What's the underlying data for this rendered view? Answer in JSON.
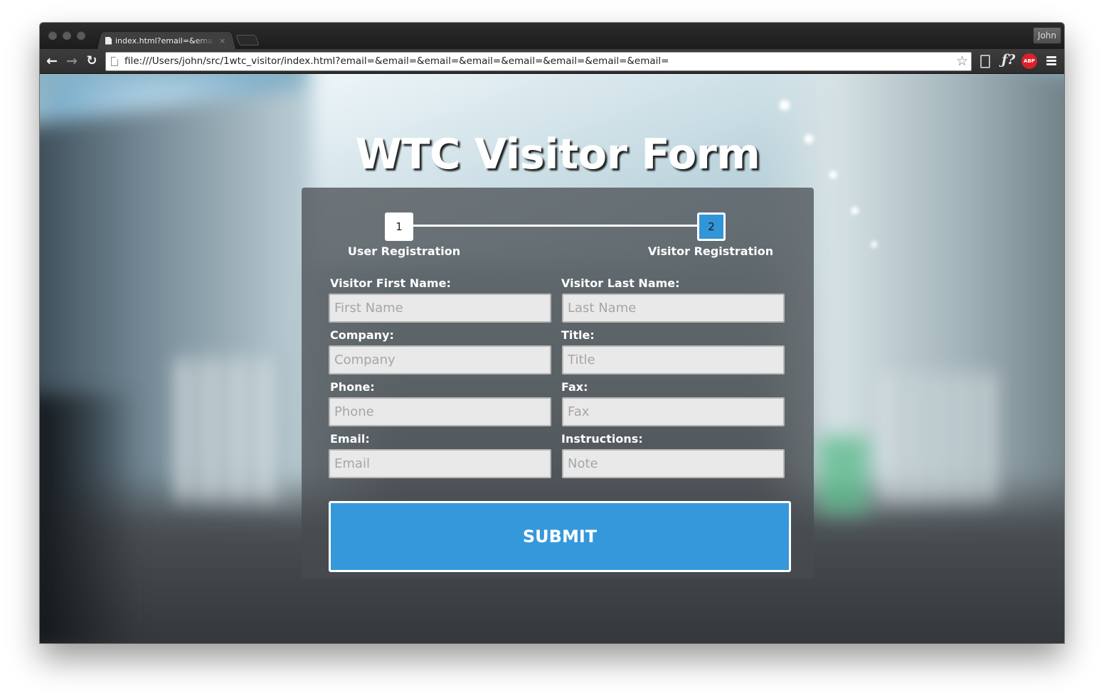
{
  "browser": {
    "tab_title": "index.html?email=&email=&email=&email=&email=&email=&email=&email=",
    "tab_close": "×",
    "profile_name": "John",
    "url": "file:///Users/john/src/1wtc_visitor/index.html?email=&email=&email=&email=&email=&email=&email=&email=",
    "icons": {
      "back": "←",
      "forward": "→",
      "reload": "↻",
      "star": "☆",
      "fquery": "ƒ?",
      "abp": "ABP"
    }
  },
  "page": {
    "title": "WTC Visitor Form"
  },
  "stepper": {
    "steps": [
      {
        "number": "1",
        "label": "User Registration",
        "active": false
      },
      {
        "number": "2",
        "label": "Visitor Registration",
        "active": true
      }
    ],
    "active_color": "#3195d8"
  },
  "form": {
    "first_name": {
      "label": "Visitor First Name:",
      "placeholder": "First Name",
      "value": ""
    },
    "last_name": {
      "label": "Visitor Last Name:",
      "placeholder": "Last Name",
      "value": ""
    },
    "company": {
      "label": "Company:",
      "placeholder": "Company",
      "value": ""
    },
    "title": {
      "label": "Title:",
      "placeholder": "Title",
      "value": ""
    },
    "phone": {
      "label": "Phone:",
      "placeholder": "Phone",
      "value": ""
    },
    "fax": {
      "label": "Fax:",
      "placeholder": "Fax",
      "value": ""
    },
    "email": {
      "label": "Email:",
      "placeholder": "Email",
      "value": ""
    },
    "instructions": {
      "label": "Instructions:",
      "placeholder": "Note",
      "value": ""
    },
    "submit_label": "SUBMIT",
    "submit_color": "#3598db"
  }
}
